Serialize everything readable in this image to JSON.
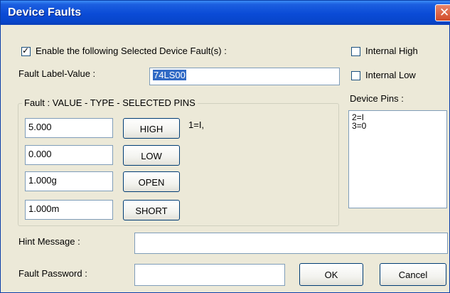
{
  "window": {
    "title": "Device Faults"
  },
  "enable_faults": {
    "label": "Enable the following Selected Device Fault(s) :",
    "checked": true
  },
  "internal_high": {
    "label": "Internal High",
    "checked": false
  },
  "internal_low": {
    "label": "Internal Low",
    "checked": false
  },
  "fault_label": {
    "label": "Fault Label-Value :",
    "value": "74LS00"
  },
  "fault_group": {
    "title": "Fault :  VALUE   -  TYPE   -  SELECTED PINS",
    "rows": [
      {
        "value": "5.000",
        "type": "HIGH",
        "pins": "1=I,"
      },
      {
        "value": "0.000",
        "type": "LOW",
        "pins": ""
      },
      {
        "value": "1.000g",
        "type": "OPEN",
        "pins": ""
      },
      {
        "value": "1.000m",
        "type": "SHORT",
        "pins": ""
      }
    ]
  },
  "device_pins": {
    "label": "Device Pins :",
    "items": [
      "2=I",
      "3=0"
    ]
  },
  "hint_message": {
    "label": "Hint Message :",
    "value": ""
  },
  "fault_password": {
    "label": "Fault Password :",
    "value": ""
  },
  "buttons": {
    "ok": "OK",
    "cancel": "Cancel"
  },
  "colors": {
    "titlebar": "#0a4bd6",
    "face": "#ece9d8",
    "selection": "#316ac5"
  },
  "icons": {
    "close": "close-icon",
    "check": "checkmark-icon"
  }
}
